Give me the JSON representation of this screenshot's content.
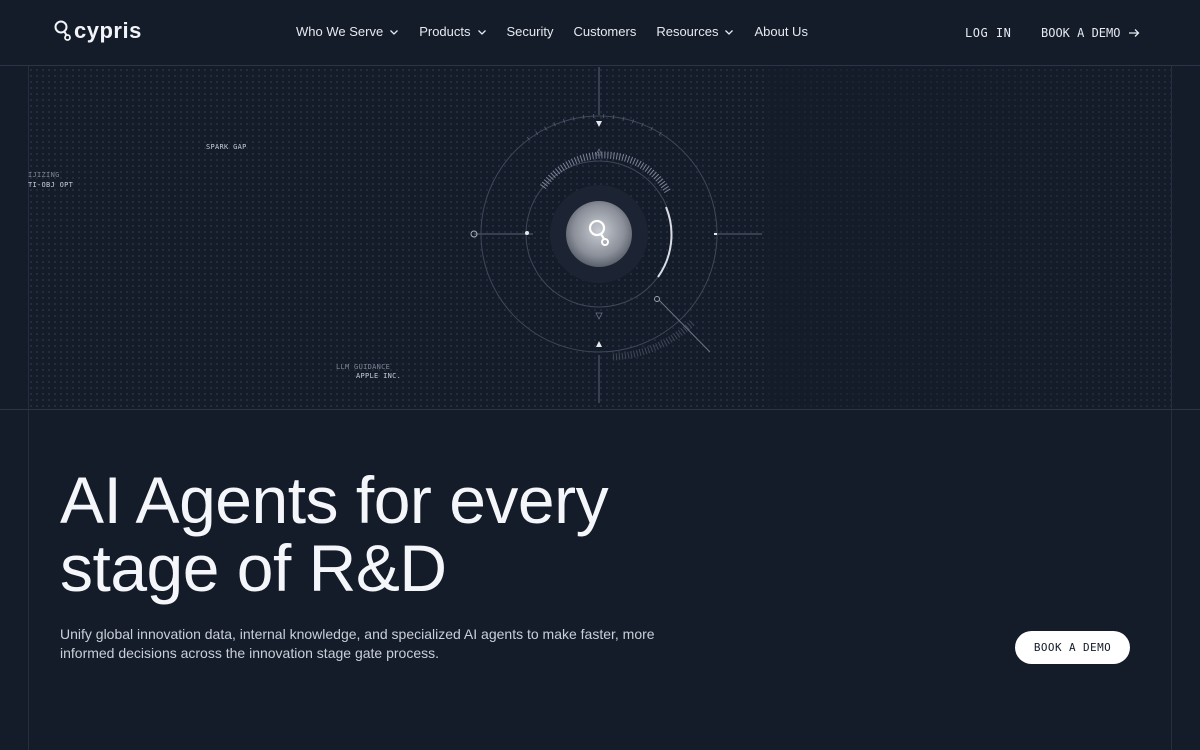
{
  "brand": {
    "name": "cypris"
  },
  "nav": {
    "items": [
      {
        "label": "Who We Serve",
        "has_dropdown": true
      },
      {
        "label": "Products",
        "has_dropdown": true
      },
      {
        "label": "Security",
        "has_dropdown": false
      },
      {
        "label": "Customers",
        "has_dropdown": false
      },
      {
        "label": "Resources",
        "has_dropdown": true
      },
      {
        "label": "About Us",
        "has_dropdown": false
      }
    ],
    "login_label": "LOG IN",
    "demo_label": "BOOK A DEMO"
  },
  "visual": {
    "labels": {
      "spark_gap": "SPARK GAP",
      "left_top": "IJIZING",
      "left_bottom": "TI-OBJ OPT",
      "llm_guidance": "LLM GUIDANCE",
      "apple": "APPLE INC."
    }
  },
  "hero": {
    "title_line1": "AI Agents for every",
    "title_line2": "stage of R&D",
    "subtitle": "Unify global innovation data, internal knowledge, and specialized AI agents to make faster, more informed decisions across the innovation stage gate process.",
    "cta_label": "BOOK A DEMO"
  },
  "colors": {
    "background": "#141b29",
    "text": "#e9edf3",
    "line": "#2c3547",
    "cta_bg": "#ffffff"
  }
}
